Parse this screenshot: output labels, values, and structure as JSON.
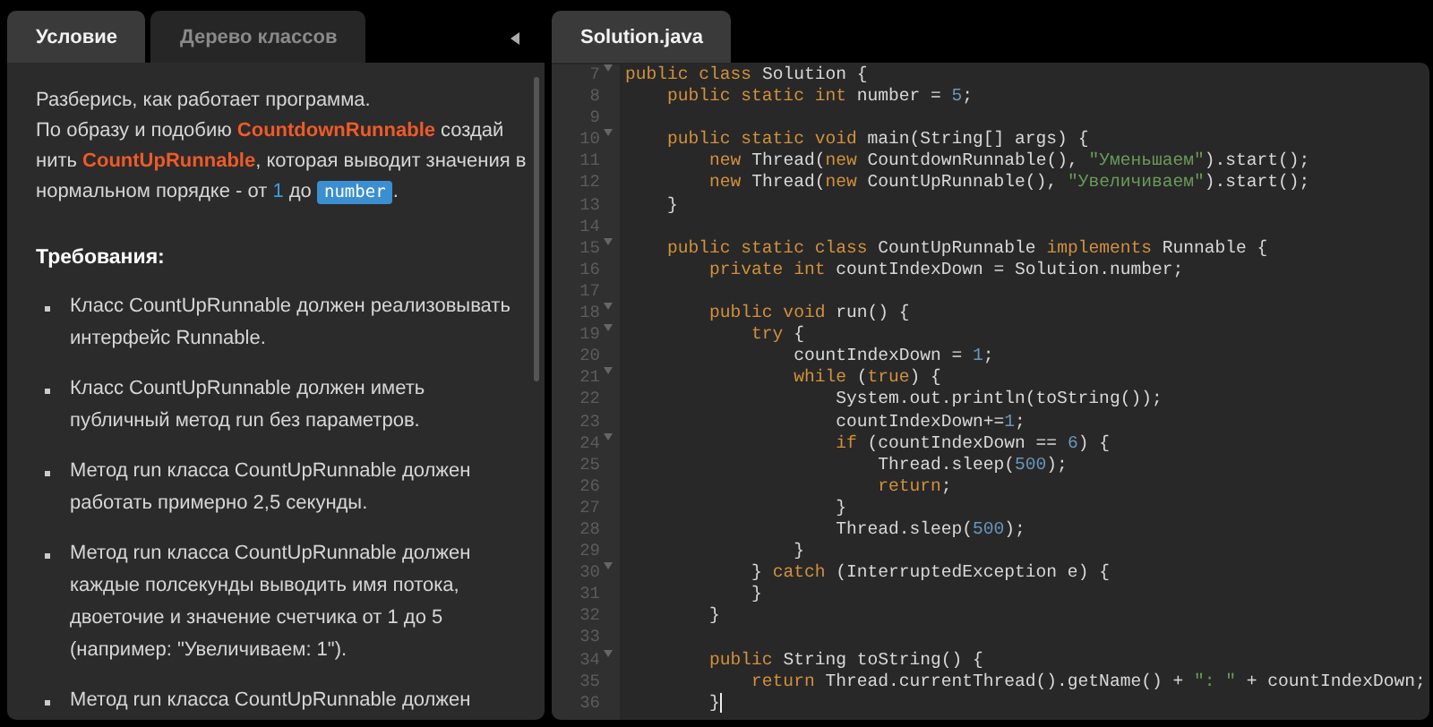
{
  "left_tabs": [
    {
      "label": "Условие",
      "selected": true
    },
    {
      "label": "Дерево классов",
      "selected": false
    }
  ],
  "intro": [
    [
      {
        "text": "Разберись, как работает программа.",
        "kind": "plain"
      }
    ],
    [
      {
        "text": "По образу и подобию ",
        "kind": "plain"
      },
      {
        "text": "CountdownRunnable",
        "kind": "class"
      },
      {
        "text": " создай нить ",
        "kind": "plain"
      },
      {
        "text": "CountUpRunnable",
        "kind": "class"
      },
      {
        "text": ", которая выводит значения в нормальном порядке - от ",
        "kind": "plain"
      },
      {
        "text": "1",
        "kind": "num"
      },
      {
        "text": " до ",
        "kind": "plain"
      },
      {
        "text": "number",
        "kind": "code"
      },
      {
        "text": ".",
        "kind": "plain"
      }
    ]
  ],
  "requirements_title": "Требования:",
  "requirements": [
    "Класс CountUpRunnable должен реализовывать интерфейс Runnable.",
    "Класс CountUpRunnable должен иметь публичный метод run без параметров.",
    "Метод run класса CountUpRunnable должен работать примерно 2,5 секунды.",
    "Метод run класса CountUpRunnable должен каждые полсекунды выводить имя потока, двоеточие и значение счетчика от 1 до 5 (например: \"Увеличиваем: 1\").",
    "Метод run класса CountUpRunnable должен"
  ],
  "editor_tabs": [
    {
      "label": "Solution.java",
      "selected": true
    }
  ],
  "code_lines": [
    {
      "number": "7",
      "fold": true,
      "tokens": [
        {
          "kind": "keyword",
          "text": "public class "
        },
        {
          "kind": "plain",
          "text": "Solution {"
        }
      ]
    },
    {
      "number": "8",
      "fold": false,
      "tokens": [
        {
          "kind": "keyword",
          "text": "    public static int "
        },
        {
          "kind": "plain",
          "text": "number = "
        },
        {
          "kind": "number",
          "text": "5"
        },
        {
          "kind": "plain",
          "text": ";"
        }
      ]
    },
    {
      "number": "9",
      "fold": false
    },
    {
      "number": "10",
      "fold": true,
      "tokens": [
        {
          "kind": "keyword",
          "text": "    public static void "
        },
        {
          "kind": "plain",
          "text": "main(String[] args) {"
        }
      ]
    },
    {
      "number": "11",
      "fold": false,
      "tokens": [
        {
          "kind": "keyword",
          "text": "        new "
        },
        {
          "kind": "plain",
          "text": "Thread("
        },
        {
          "kind": "keyword",
          "text": "new "
        },
        {
          "kind": "plain",
          "text": "CountdownRunnable(), "
        },
        {
          "kind": "string",
          "text": "\"Уменьшаем\""
        },
        {
          "kind": "plain",
          "text": ").start();"
        }
      ]
    },
    {
      "number": "12",
      "fold": false,
      "tokens": [
        {
          "kind": "keyword",
          "text": "        new "
        },
        {
          "kind": "plain",
          "text": "Thread("
        },
        {
          "kind": "keyword",
          "text": "new "
        },
        {
          "kind": "plain",
          "text": "CountUpRunnable(), "
        },
        {
          "kind": "string",
          "text": "\"Увеличиваем\""
        },
        {
          "kind": "plain",
          "text": ").start();"
        }
      ]
    },
    {
      "number": "13",
      "fold": false,
      "tokens": [
        {
          "kind": "plain",
          "text": "    }"
        }
      ]
    },
    {
      "number": "14",
      "fold": false
    },
    {
      "number": "15",
      "fold": true,
      "tokens": [
        {
          "kind": "keyword",
          "text": "    public static class "
        },
        {
          "kind": "plain",
          "text": "CountUpRunnable "
        },
        {
          "kind": "keyword",
          "text": "implements "
        },
        {
          "kind": "plain",
          "text": "Runnable {"
        }
      ]
    },
    {
      "number": "16",
      "fold": false,
      "tokens": [
        {
          "kind": "keyword",
          "text": "        private int "
        },
        {
          "kind": "plain",
          "text": "countIndexDown = Solution.number;"
        }
      ]
    },
    {
      "number": "17",
      "fold": false
    },
    {
      "number": "18",
      "fold": true,
      "tokens": [
        {
          "kind": "keyword",
          "text": "        public void "
        },
        {
          "kind": "plain",
          "text": "run() {"
        }
      ]
    },
    {
      "number": "19",
      "fold": true,
      "tokens": [
        {
          "kind": "keyword",
          "text": "            try "
        },
        {
          "kind": "plain",
          "text": "{"
        }
      ]
    },
    {
      "number": "20",
      "fold": false,
      "tokens": [
        {
          "kind": "plain",
          "text": "                countIndexDown = "
        },
        {
          "kind": "number",
          "text": "1"
        },
        {
          "kind": "plain",
          "text": ";"
        }
      ]
    },
    {
      "number": "21",
      "fold": true,
      "tokens": [
        {
          "kind": "keyword",
          "text": "                while "
        },
        {
          "kind": "plain",
          "text": "("
        },
        {
          "kind": "keyword",
          "text": "true"
        },
        {
          "kind": "plain",
          "text": ") {"
        }
      ]
    },
    {
      "number": "22",
      "fold": false,
      "tokens": [
        {
          "kind": "plain",
          "text": "                    System.out.println(toString());"
        }
      ]
    },
    {
      "number": "23",
      "fold": false,
      "tokens": [
        {
          "kind": "plain",
          "text": "                    countIndexDown+="
        },
        {
          "kind": "number",
          "text": "1"
        },
        {
          "kind": "plain",
          "text": ";"
        }
      ]
    },
    {
      "number": "24",
      "fold": true,
      "tokens": [
        {
          "kind": "keyword",
          "text": "                    if "
        },
        {
          "kind": "plain",
          "text": "(countIndexDown == "
        },
        {
          "kind": "number",
          "text": "6"
        },
        {
          "kind": "plain",
          "text": ") {"
        }
      ]
    },
    {
      "number": "25",
      "fold": false,
      "tokens": [
        {
          "kind": "plain",
          "text": "                        Thread.sleep("
        },
        {
          "kind": "number",
          "text": "500"
        },
        {
          "kind": "plain",
          "text": ");"
        }
      ]
    },
    {
      "number": "26",
      "fold": false,
      "tokens": [
        {
          "kind": "keyword",
          "text": "                        return"
        },
        {
          "kind": "plain",
          "text": ";"
        }
      ]
    },
    {
      "number": "27",
      "fold": false,
      "tokens": [
        {
          "kind": "plain",
          "text": "                    }"
        }
      ]
    },
    {
      "number": "28",
      "fold": false,
      "tokens": [
        {
          "kind": "plain",
          "text": "                    Thread.sleep("
        },
        {
          "kind": "number",
          "text": "500"
        },
        {
          "kind": "plain",
          "text": ");"
        }
      ]
    },
    {
      "number": "29",
      "fold": false,
      "tokens": [
        {
          "kind": "plain",
          "text": "                }"
        }
      ]
    },
    {
      "number": "30",
      "fold": true,
      "tokens": [
        {
          "kind": "plain",
          "text": "            } "
        },
        {
          "kind": "keyword",
          "text": "catch "
        },
        {
          "kind": "plain",
          "text": "(InterruptedException e) {"
        }
      ]
    },
    {
      "number": "31",
      "fold": false,
      "tokens": [
        {
          "kind": "plain",
          "text": "            }"
        }
      ]
    },
    {
      "number": "32",
      "fold": false,
      "tokens": [
        {
          "kind": "plain",
          "text": "        }"
        }
      ]
    },
    {
      "number": "33",
      "fold": false
    },
    {
      "number": "34",
      "fold": true,
      "tokens": [
        {
          "kind": "keyword",
          "text": "        public "
        },
        {
          "kind": "plain",
          "text": "String toString() {"
        }
      ]
    },
    {
      "number": "35",
      "fold": false,
      "tokens": [
        {
          "kind": "keyword",
          "text": "            return "
        },
        {
          "kind": "plain",
          "text": "Thread.currentThread().getName() + "
        },
        {
          "kind": "string",
          "text": "\": \""
        },
        {
          "kind": "plain",
          "text": " + countIndexDown;"
        }
      ]
    },
    {
      "number": "36",
      "fold": false,
      "cursor": true,
      "tokens": [
        {
          "kind": "plain",
          "text": "        }"
        }
      ]
    }
  ]
}
